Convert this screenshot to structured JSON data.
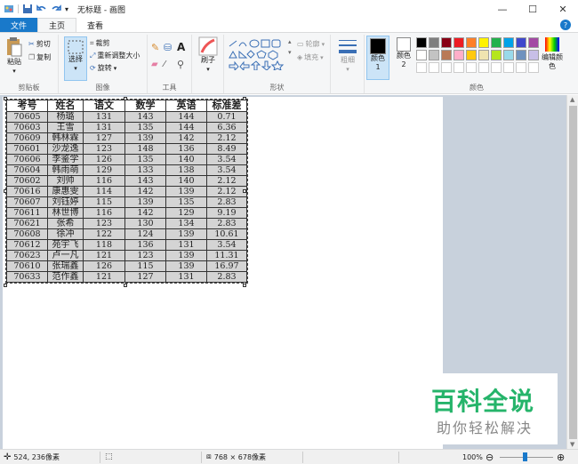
{
  "window": {
    "title": "无标题 - 画图",
    "minimize": "—",
    "maximize": "☐",
    "close": "✕"
  },
  "tabs": {
    "file": "文件",
    "home": "主页",
    "view": "查看",
    "help": "?"
  },
  "ribbon": {
    "clipboard": {
      "label": "剪贴板",
      "paste": "粘贴",
      "cut": "剪切",
      "copy": "复制"
    },
    "image": {
      "label": "图像",
      "select": "选择",
      "crop": "裁剪",
      "resize": "重新调整大小",
      "rotate": "旋转"
    },
    "tools": {
      "label": "工具"
    },
    "brushes": {
      "label": "刷子"
    },
    "shapes": {
      "label": "形状",
      "outline": "轮廓",
      "fill": "填充"
    },
    "size": {
      "label": "粗细"
    },
    "color1": "颜色 1",
    "color2": "颜色 2",
    "colors": {
      "label": "颜色",
      "edit": "编辑颜色"
    },
    "palette_row1": [
      "#000000",
      "#7f7f7f",
      "#880015",
      "#ed1c24",
      "#ff7f27",
      "#fff200",
      "#22b14c",
      "#00a2e8",
      "#3f48cc",
      "#a349a4"
    ],
    "palette_row2": [
      "#ffffff",
      "#c3c3c3",
      "#b97a57",
      "#ffaec9",
      "#ffc90e",
      "#efe4b0",
      "#b5e61d",
      "#99d9ea",
      "#7092be",
      "#c8bfe7"
    ],
    "color1_value": "#000000",
    "color2_value": "#ffffff"
  },
  "sheet": {
    "headers": [
      "考号",
      "姓名",
      "语文",
      "数学",
      "英语",
      "标准差"
    ],
    "rows": [
      [
        "70605",
        "杨璐",
        "131",
        "143",
        "144",
        "0.71"
      ],
      [
        "70603",
        "王雪",
        "131",
        "135",
        "144",
        "6.36"
      ],
      [
        "70609",
        "韩林霖",
        "127",
        "139",
        "142",
        "2.12"
      ],
      [
        "70601",
        "沙龙逸",
        "123",
        "148",
        "136",
        "8.49"
      ],
      [
        "70606",
        "李鉴学",
        "126",
        "135",
        "140",
        "3.54"
      ],
      [
        "70604",
        "韩雨萌",
        "129",
        "133",
        "138",
        "3.54"
      ],
      [
        "70602",
        "刘帅",
        "116",
        "143",
        "140",
        "2.12"
      ],
      [
        "70616",
        "康惠雯",
        "114",
        "142",
        "139",
        "2.12"
      ],
      [
        "70607",
        "刘钰婷",
        "115",
        "139",
        "135",
        "2.83"
      ],
      [
        "70611",
        "林世博",
        "116",
        "142",
        "129",
        "9.19"
      ],
      [
        "70621",
        "张希",
        "123",
        "130",
        "134",
        "2.83"
      ],
      [
        "70608",
        "徐冲",
        "122",
        "124",
        "139",
        "10.61"
      ],
      [
        "70612",
        "苑宇飞",
        "118",
        "136",
        "131",
        "3.54"
      ],
      [
        "70623",
        "卢一凡",
        "121",
        "123",
        "139",
        "11.31"
      ],
      [
        "70610",
        "张瑞鑫",
        "126",
        "115",
        "139",
        "16.97"
      ],
      [
        "70633",
        "范作鑫",
        "121",
        "127",
        "131",
        "2.83"
      ]
    ]
  },
  "watermark": {
    "title": "百科全说",
    "subtitle": "助你轻松解决"
  },
  "status": {
    "cursor_pos": "524, 236像素",
    "image_size": "768 × 678像素",
    "zoom": "100%"
  }
}
